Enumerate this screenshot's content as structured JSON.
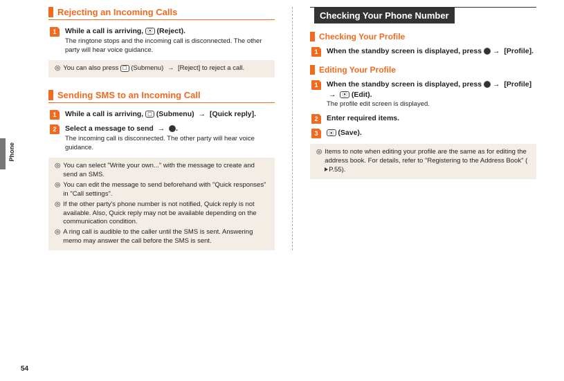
{
  "side": {
    "label": "Phone"
  },
  "page_number": "54",
  "left": {
    "sec1": {
      "title": "Rejecting an Incoming Calls",
      "step1_num": "1",
      "step1_title_a": "While a call is arriving, ",
      "step1_key": "⦿",
      "step1_title_b": " (Reject).",
      "step1_sub": "The ringtone stops and the incoming call is disconnected. The other party will hear voice guidance.",
      "note_a": "You can also press ",
      "note_key": "☐",
      "note_b": " (Submenu) ",
      "note_c": " [Reject] to reject a call."
    },
    "sec2": {
      "title": "Sending SMS to an Incoming Call",
      "step1_num": "1",
      "step1_a": "While a call is arriving, ",
      "step1_key": "☐",
      "step1_b": " (Submenu) ",
      "step1_c": " [Quick reply].",
      "step2_num": "2",
      "step2_a": "Select a message to send ",
      "step2_b": ".",
      "step2_sub": "The incoming call is disconnected. The other party will hear voice guidance.",
      "notes": [
        "You can select \"Write your own...\" with the message to create and send an SMS.",
        "You can edit the message to send beforehand with \"Quick responses\" in \"Call settings\".",
        "If the other party's phone number is not notified, Quick reply is not available. Also, Quick reply may not be available depending on the communication condition.",
        "A ring call is audible to the caller until the SMS is sent. Answering memo may answer the call before the SMS is sent."
      ]
    }
  },
  "right": {
    "main_title": "Checking Your Phone Number",
    "sec1": {
      "title": "Checking Your Profile",
      "step1_num": "1",
      "step1_a": "When the standby screen is displayed, press ",
      "step1_b": " [Profile]."
    },
    "sec2": {
      "title": "Editing Your Profile",
      "step1_num": "1",
      "step1_a": "When the standby screen is displayed, press ",
      "step1_b": " [Profile] ",
      "step1_key": "⦿",
      "step1_c": " (Edit).",
      "step1_sub": "The profile edit screen is displayed.",
      "step2_num": "2",
      "step2_a": "Enter required items.",
      "step3_num": "3",
      "step3_key": "⦿",
      "step3_a": " (Save).",
      "note_a": "Items to note when editing your profile are the same as for editing the address book. For details, refer to \"Registering to the Address Book\" (",
      "note_b": "P.55)."
    }
  }
}
